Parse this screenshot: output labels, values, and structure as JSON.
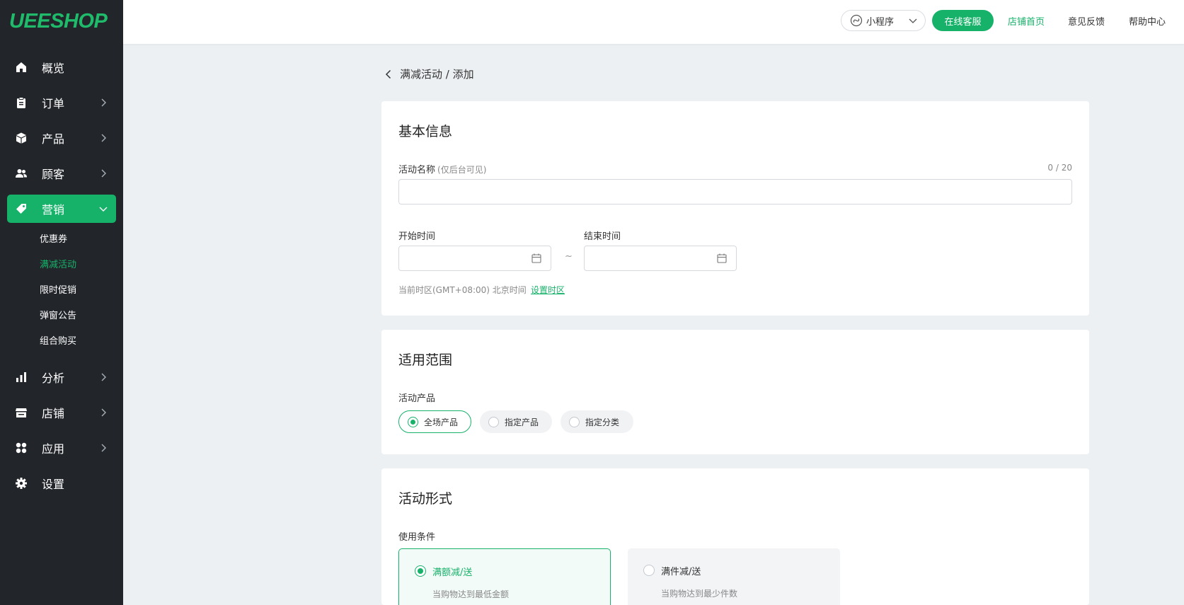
{
  "brand": {
    "logo_text": "UEESHOP",
    "accent": "#17b26a",
    "sidebar_bg": "#22262b"
  },
  "sidebar": {
    "items": [
      {
        "label": "概览",
        "icon": "home-icon"
      },
      {
        "label": "订单",
        "icon": "clipboard-icon"
      },
      {
        "label": "产品",
        "icon": "box-icon"
      },
      {
        "label": "顾客",
        "icon": "users-icon"
      },
      {
        "label": "营销",
        "icon": "tag-icon"
      },
      {
        "label": "分析",
        "icon": "bar-chart-icon"
      },
      {
        "label": "店铺",
        "icon": "store-icon"
      },
      {
        "label": "应用",
        "icon": "apps-icon"
      },
      {
        "label": "设置",
        "icon": "gear-icon"
      }
    ],
    "marketing_sub": [
      "优惠券",
      "满减活动",
      "限时促销",
      "弹窗公告",
      "组合购买"
    ]
  },
  "topbar": {
    "mini_program": "小程序",
    "service": "在线客服",
    "store_home": "店铺首页",
    "feedback": "意见反馈",
    "help": "帮助中心"
  },
  "breadcrumb": "满减活动 / 添加",
  "basic": {
    "title": "基本信息",
    "name_label": "活动名称",
    "name_hint": "(仅后台可见)",
    "name_counter": "0 / 20",
    "name_value": "",
    "start_label": "开始时间",
    "end_label": "结束时间",
    "range_sep": "~",
    "timezone": "当前时区(GMT+08:00) 北京时间",
    "timezone_link": "设置时区"
  },
  "scope": {
    "title": "适用范围",
    "label": "活动产品",
    "options": [
      "全场产品",
      "指定产品",
      "指定分类"
    ],
    "selected": "全场产品"
  },
  "form": {
    "title": "活动形式",
    "label": "使用条件",
    "options": [
      {
        "title": "满额减/送",
        "desc": "当购物达到最低金额"
      },
      {
        "title": "满件减/送",
        "desc": "当购物达到最少件数"
      }
    ],
    "selected": "满额减/送"
  }
}
